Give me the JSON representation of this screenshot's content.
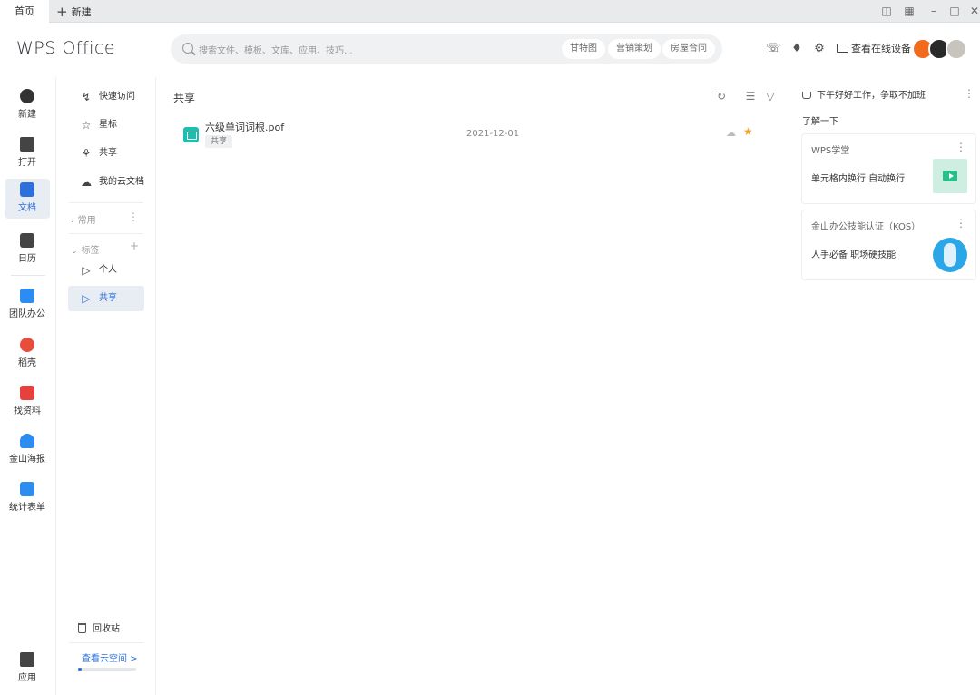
{
  "tabs": {
    "home": "首页",
    "new": "新建"
  },
  "header": {
    "logo": "WPS Office",
    "search_placeholder": "搜索文件、模板、文库、应用、技巧...",
    "chips": [
      "甘特图",
      "营销策划",
      "房屋合同"
    ],
    "device_button": "查看在线设备"
  },
  "rail": {
    "items": [
      {
        "label": "新建",
        "icon": "plus-circle-icon",
        "color": "#333333"
      },
      {
        "label": "打开",
        "icon": "folder-icon",
        "color": "#333333"
      },
      {
        "label": "文档",
        "icon": "document-icon",
        "color": "#2d6fdb"
      },
      {
        "label": "日历",
        "icon": "calendar-icon",
        "color": "#333333"
      },
      {
        "label": "团队办公",
        "icon": "team-icon",
        "color": "#2d8cf0"
      },
      {
        "label": "稻壳",
        "icon": "docer-icon",
        "color": "#e84c3d"
      },
      {
        "label": "找资料",
        "icon": "search-material-icon",
        "color": "#e8413d"
      },
      {
        "label": "金山海报",
        "icon": "poster-icon",
        "color": "#2d8cf0"
      },
      {
        "label": "统计表单",
        "icon": "form-icon",
        "color": "#2d8cf0"
      }
    ],
    "apps": "应用"
  },
  "nav2": {
    "quick_access": "快速访问",
    "starred": "星标",
    "shared": "共享",
    "my_cloud": "我的云文档",
    "common_group": "常用",
    "tags_group": "标签",
    "tag_personal": "个人",
    "tag_shared": "共享",
    "trash": "回收站",
    "cloud_link": "查看云空间 >",
    "cloud_usage": 0.06
  },
  "main": {
    "title": "共享",
    "files": [
      {
        "name": "六级单词词根.pof",
        "tag": "共享",
        "date": "2021-12-01",
        "starred": true
      }
    ]
  },
  "right": {
    "greeting": "下午好好工作，争取不加班",
    "learn": "了解一下",
    "cards": [
      {
        "title": "WPS学堂",
        "desc": "单元格内换行 自动换行"
      },
      {
        "title": "金山办公技能认证（KOS）",
        "desc": "人手必备 职场硬技能"
      }
    ]
  },
  "colors": {
    "accent": "#2d6fdb",
    "star": "#f5a623",
    "file_icon": "#1bbfb0"
  }
}
